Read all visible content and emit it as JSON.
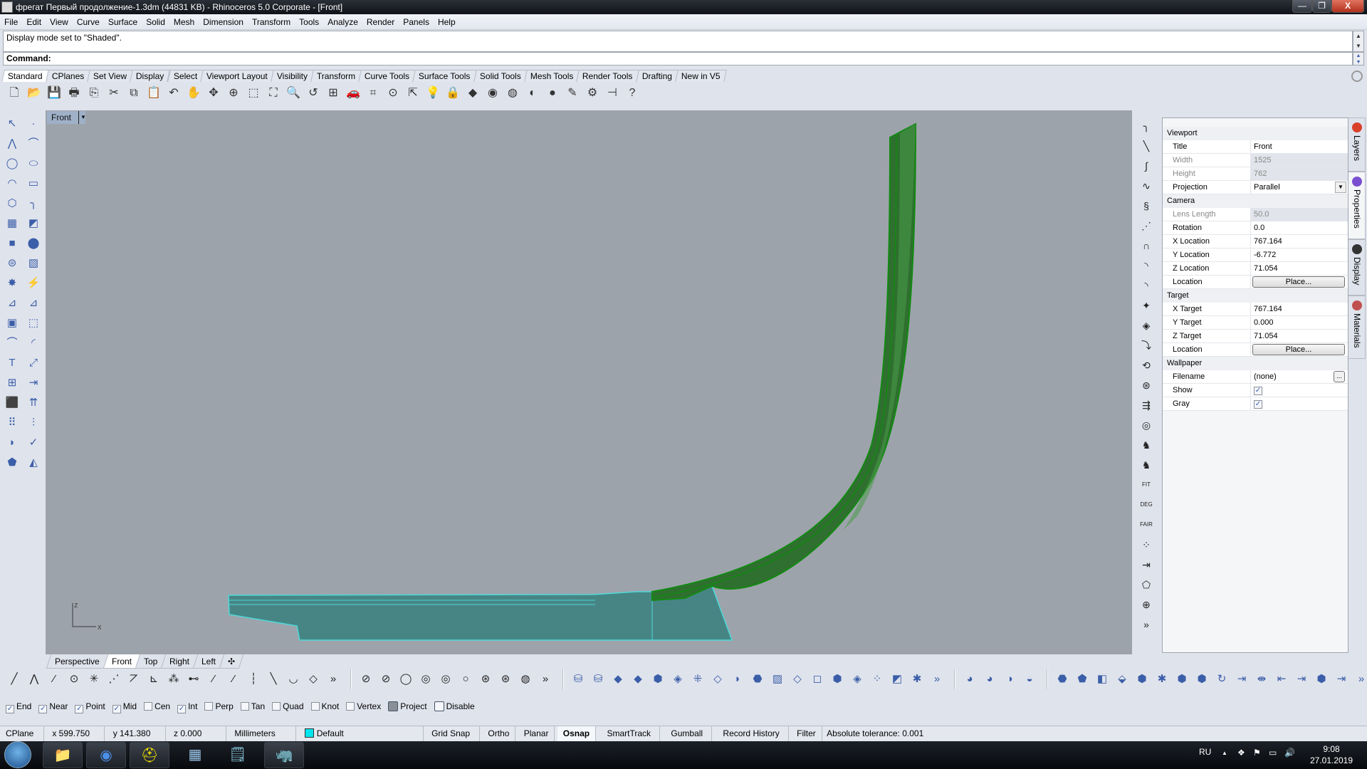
{
  "window": {
    "title": "фрегат Первый продолжение-1.3dm (44831 KB) - Rhinoceros  5.0 Corporate - [Front]",
    "minimize": "—",
    "restore": "❐",
    "close": "X"
  },
  "menu": [
    "File",
    "Edit",
    "View",
    "Curve",
    "Surface",
    "Solid",
    "Mesh",
    "Dimension",
    "Transform",
    "Tools",
    "Analyze",
    "Render",
    "Panels",
    "Help"
  ],
  "command": {
    "history": "Display mode set to \"Shaded\".",
    "prompt": "Command:",
    "scroll_up": "▲",
    "scroll_down": "▼"
  },
  "toolbar_tabs": [
    "Standard",
    "CPlanes",
    "Set View",
    "Display",
    "Select",
    "Viewport Layout",
    "Visibility",
    "Transform",
    "Curve Tools",
    "Surface Tools",
    "Solid Tools",
    "Mesh Tools",
    "Render Tools",
    "Drafting",
    "New in V5"
  ],
  "toolbar_tabs_active": "Standard",
  "standard_icons": [
    {
      "name": "new-icon",
      "glyph": "🗋"
    },
    {
      "name": "open-icon",
      "glyph": "📂"
    },
    {
      "name": "save-icon",
      "glyph": "💾"
    },
    {
      "name": "print-icon",
      "glyph": "🖶"
    },
    {
      "name": "import-icon",
      "glyph": "⎘"
    },
    {
      "name": "cut-icon",
      "glyph": "✂"
    },
    {
      "name": "copy-icon",
      "glyph": "⧉"
    },
    {
      "name": "paste-icon",
      "glyph": "📋"
    },
    {
      "name": "undo-icon",
      "glyph": "↶"
    },
    {
      "name": "pan-icon",
      "glyph": "✋"
    },
    {
      "name": "rotate-view-icon",
      "glyph": "✥"
    },
    {
      "name": "zoom-dynamic-icon",
      "glyph": "⊕"
    },
    {
      "name": "zoom-window-icon",
      "glyph": "⬚"
    },
    {
      "name": "zoom-extents-icon",
      "glyph": "⛶"
    },
    {
      "name": "zoom-selected-icon",
      "glyph": "🔍"
    },
    {
      "name": "undo-view-icon",
      "glyph": "↺"
    },
    {
      "name": "four-viewports-icon",
      "glyph": "⊞"
    },
    {
      "name": "car-icon",
      "glyph": "🚗"
    },
    {
      "name": "cplane-icon",
      "glyph": "⌗"
    },
    {
      "name": "circle-icon",
      "glyph": "⊙"
    },
    {
      "name": "select-icon",
      "glyph": "⇱"
    },
    {
      "name": "light-bulb-icon",
      "glyph": "💡"
    },
    {
      "name": "lock-icon",
      "glyph": "🔒"
    },
    {
      "name": "layer-icon",
      "glyph": "◆"
    },
    {
      "name": "color-wheel-icon",
      "glyph": "◉"
    },
    {
      "name": "wireframe-sphere-icon",
      "glyph": "◍"
    },
    {
      "name": "shaded-sphere-icon",
      "glyph": "◐"
    },
    {
      "name": "render-sphere-icon",
      "glyph": "●"
    },
    {
      "name": "pen-icon",
      "glyph": "✎"
    },
    {
      "name": "gear-icon",
      "glyph": "⚙"
    },
    {
      "name": "dimension-icon",
      "glyph": "⊣"
    },
    {
      "name": "help-icon",
      "glyph": "?"
    }
  ],
  "left_toolbar_icons": [
    "select-arrow-icon",
    "point-icon",
    "polyline-icon",
    "curve-icon",
    "circle-icon",
    "ellipse-icon",
    "arc-icon",
    "rectangle-icon",
    "polygon-icon",
    "fillet-curve-icon",
    "surface-from-points-icon",
    "sweep-icon",
    "box-icon",
    "boolean-union-icon",
    "extrude-icon",
    "mesh-surface-icon",
    "explode-icon",
    "split-icon",
    "trim-icon",
    "trim-alt-icon",
    "group-icon",
    "ungroup-icon",
    "offset-icon",
    "fillet-icon",
    "text-icon",
    "scale-icon",
    "array-icon",
    "align-icon",
    "solid-tools-icon",
    "extrude-up-icon",
    "grid-array-icon",
    "dimension-icon",
    "analyze-icon",
    "check-icon",
    "solid-primitives-icon",
    "render-icon"
  ],
  "left_toolbar_glyphs": [
    "↖",
    "·",
    "⋀",
    "⌒",
    "◯",
    "⬭",
    "◠",
    "▭",
    "⬡",
    "╮",
    "▦",
    "◩",
    "■",
    "⬤",
    "⊜",
    "▧",
    "✸",
    "⚡",
    "⊿",
    "⊿",
    "▣",
    "⬚",
    "⌒",
    "◜",
    "T",
    "⤢",
    "⊞",
    "⇥",
    "⬛",
    "⇈",
    "⠿",
    "⫶",
    "◗",
    "✓",
    "⬟",
    "◭"
  ],
  "viewport": {
    "title": "Front",
    "caret": "▼",
    "axis_z": "z",
    "axis_x": "x"
  },
  "viewport_tabs": [
    "Perspective",
    "Front",
    "Top",
    "Right",
    "Left"
  ],
  "viewport_tabs_active": "Front",
  "viewport_add": "✣",
  "right_toolbar_glyphs": [
    "╮",
    "╲",
    "∫",
    "∿",
    "§",
    "⋰",
    "∩",
    "◝",
    "◝",
    "✦",
    "◈",
    "⤵",
    "⟲",
    "⊛",
    "⇶",
    "◎",
    "♞",
    "♞",
    "FIT",
    "DEG",
    "FAIR",
    "⁘",
    "⇥",
    "⬠",
    "⊕",
    "»"
  ],
  "right_toolbar_icons": [
    "fillet-icon",
    "blend-icon",
    "curve-blend-icon",
    "rebuild-icon",
    "adjust-seam-icon",
    "polyline-fit-icon",
    "arc-icon",
    "offset-icon",
    "extend-icon",
    "sphere-icon",
    "surface-icon",
    "connect-icon",
    "rotate-icon",
    "control-points-icon",
    "flow-icon",
    "cylinder-icon",
    "person-icon",
    "person-gear-icon",
    "fit-icon",
    "deg-icon",
    "fair-icon",
    "points-icon",
    "match-icon",
    "polygon-icon",
    "gumball-icon",
    "more-icon"
  ],
  "properties": {
    "sections": [
      {
        "title": "Viewport",
        "rows": [
          {
            "label": "Title",
            "value": "Front",
            "disabled": false,
            "type": "text"
          },
          {
            "label": "Width",
            "value": "1525",
            "disabled": true,
            "type": "text"
          },
          {
            "label": "Height",
            "value": "762",
            "disabled": true,
            "type": "text"
          },
          {
            "label": "Projection",
            "value": "Parallel",
            "disabled": false,
            "type": "select"
          }
        ]
      },
      {
        "title": "Camera",
        "rows": [
          {
            "label": "Lens Length",
            "value": "50.0",
            "disabled": true,
            "type": "text"
          },
          {
            "label": "Rotation",
            "value": "0.0",
            "disabled": false,
            "type": "text"
          },
          {
            "label": "X Location",
            "value": "767.164",
            "disabled": false,
            "type": "text"
          },
          {
            "label": "Y Location",
            "value": "-6.772",
            "disabled": false,
            "type": "text"
          },
          {
            "label": "Z Location",
            "value": "71.054",
            "disabled": false,
            "type": "text"
          },
          {
            "label": "Location",
            "value": "Place...",
            "disabled": false,
            "type": "button"
          }
        ]
      },
      {
        "title": "Target",
        "rows": [
          {
            "label": "X Target",
            "value": "767.164",
            "disabled": false,
            "type": "text"
          },
          {
            "label": "Y Target",
            "value": "0.000",
            "disabled": false,
            "type": "text"
          },
          {
            "label": "Z Target",
            "value": "71.054",
            "disabled": false,
            "type": "text"
          },
          {
            "label": "Location",
            "value": "Place...",
            "disabled": false,
            "type": "button"
          }
        ]
      },
      {
        "title": "Wallpaper",
        "rows": [
          {
            "label": "Filename",
            "value": "(none)",
            "disabled": false,
            "type": "file"
          },
          {
            "label": "Show",
            "value": true,
            "disabled": false,
            "type": "checkbox"
          },
          {
            "label": "Gray",
            "value": true,
            "disabled": false,
            "type": "checkbox"
          }
        ]
      }
    ],
    "file_button": "...",
    "dropdown": "▼"
  },
  "side_tabs": [
    {
      "label": "Layers",
      "color": "#d9402b",
      "active": false
    },
    {
      "label": "Properties",
      "color": "#7a4fd0",
      "active": true
    },
    {
      "label": "Display",
      "color": "#333333",
      "active": false
    },
    {
      "label": "Materials",
      "color": "#c05050",
      "active": false
    }
  ],
  "bottom_toolbar_groups": [
    {
      "glyphs": [
        "╱",
        "⋀",
        "⁄",
        "⊙",
        "✳",
        "⋰",
        "⦢",
        "⊾",
        "⁂",
        "⊷",
        "⁄",
        "⁄",
        "┆",
        "╲",
        "◡",
        "◇",
        "»"
      ],
      "names": [
        "line-icon",
        "polyline-icon",
        "line-segments-icon",
        "circle-point-icon",
        "line-normal-icon",
        "line-tangent-icon",
        "angle-line-icon",
        "bisector-icon",
        "perpendicular-icon",
        "line-extend-icon",
        "line-two-points-icon",
        "line-icon-2",
        "vertical-line-icon",
        "diagonal-line-icon",
        "arc-curve-icon",
        "polygon-icon",
        "more-icon"
      ],
      "blue": false
    },
    {
      "glyphs": [
        "⊘",
        "⊘",
        "◯",
        "◎",
        "◎",
        "○",
        "⊛",
        "⊛",
        "◍",
        "»"
      ],
      "names": [
        "circle-center-icon",
        "circle-diameter-icon",
        "circle-3pt-icon",
        "circle-tangent-icon",
        "circle-around-icon",
        "circle-icon",
        "circle-tangent-3-icon",
        "circle-tangent-2-icon",
        "circle-fit-icon",
        "more-icon"
      ],
      "blue": false
    },
    {
      "glyphs": [
        "⛁",
        "⛁",
        "◆",
        "◆",
        "⬢",
        "◈",
        "⁜",
        "◇",
        "◗",
        "⬣",
        "▨",
        "◇",
        "◻",
        "⬢",
        "◈",
        "⁘",
        "◩",
        "✱",
        "»"
      ],
      "names": [
        "extrude-icon",
        "extrude-tapered-icon",
        "surface-icon",
        "plane-icon",
        "box-surface-icon",
        "loft-icon",
        "patch-icon",
        "edge-surface-icon",
        "sweep1-icon",
        "sweep2-icon",
        "network-icon",
        "revolve-icon",
        "blend-srf-icon",
        "offset-srf-icon",
        "rail-revolve-icon",
        "drape-icon",
        "planar-icon",
        "unroll-icon",
        "more-icon"
      ],
      "blue": true
    },
    {
      "glyphs": [
        "◕",
        "◕",
        "◑",
        "◒"
      ],
      "names": [
        "boolean-union-icon",
        "boolean-difference-icon",
        "boolean-intersection-icon",
        "boolean-split-icon"
      ],
      "blue": true
    },
    {
      "glyphs": [
        "⬣",
        "⬟",
        "◧",
        "⬙",
        "⬢",
        "✱",
        "⬢",
        "⬢",
        "↻",
        "⇥",
        "⇼",
        "⇤",
        "⇥",
        "⬢",
        "⇥",
        "»"
      ],
      "names": [
        "cap-icon",
        "extract-icon",
        "split-solid-icon",
        "wire-cut-icon",
        "fillet-edge-icon",
        "chamfer-edge-icon",
        "solid-box-icon",
        "solid-prism-icon",
        "twist-icon",
        "extrude-face-icon",
        "move-face-icon",
        "move-edge-icon",
        "split-face-icon",
        "merge-face-icon",
        "shell-icon",
        "more-icon"
      ],
      "blue": true
    }
  ],
  "osnap": [
    {
      "label": "End",
      "checked": true,
      "kind": "check"
    },
    {
      "label": "Near",
      "checked": true,
      "kind": "check"
    },
    {
      "label": "Point",
      "checked": true,
      "kind": "check"
    },
    {
      "label": "Mid",
      "checked": true,
      "kind": "check"
    },
    {
      "label": "Cen",
      "checked": false,
      "kind": "check"
    },
    {
      "label": "Int",
      "checked": true,
      "kind": "check"
    },
    {
      "label": "Perp",
      "checked": false,
      "kind": "check"
    },
    {
      "label": "Tan",
      "checked": false,
      "kind": "check"
    },
    {
      "label": "Quad",
      "checked": false,
      "kind": "check"
    },
    {
      "label": "Knot",
      "checked": false,
      "kind": "check"
    },
    {
      "label": "Vertex",
      "checked": false,
      "kind": "check"
    },
    {
      "label": "Project",
      "checked": true,
      "kind": "toggle"
    },
    {
      "label": "Disable",
      "checked": false,
      "kind": "toggle"
    }
  ],
  "status": {
    "cplane": "CPlane",
    "x": "x 599.750",
    "y": "y 141.380",
    "z": "z 0.000",
    "units": "Millimeters",
    "layer": "Default",
    "layer_color": "#00e5ee",
    "grid_snap": "Grid Snap",
    "ortho": "Ortho",
    "planar": "Planar",
    "osnap": "Osnap",
    "smarttrack": "SmartTrack",
    "gumball": "Gumball",
    "record_history": "Record History",
    "filter": "Filter",
    "tolerance": "Absolute tolerance: 0.001"
  },
  "taskbar": {
    "apps": [
      {
        "name": "explorer-icon",
        "glyph": "📁"
      },
      {
        "name": "chrome-icon",
        "glyph": "◉"
      },
      {
        "name": "construction-helmet-icon",
        "glyph": "⛑"
      },
      {
        "name": "calculator-icon",
        "glyph": "▦"
      },
      {
        "name": "notepad-icon",
        "glyph": "🗒"
      },
      {
        "name": "rhino-icon",
        "glyph": "🦏"
      }
    ],
    "lang": "RU",
    "tray_up": "▲",
    "time": "9:08",
    "date": "27.01.2019"
  },
  "colors": {
    "viewport_bg": "#9da3ab",
    "hull_green": "#2d6b2d",
    "hull_edge": "#1a8a1a",
    "deck_teal": "#478585",
    "deck_edge": "#4dd8d8"
  }
}
